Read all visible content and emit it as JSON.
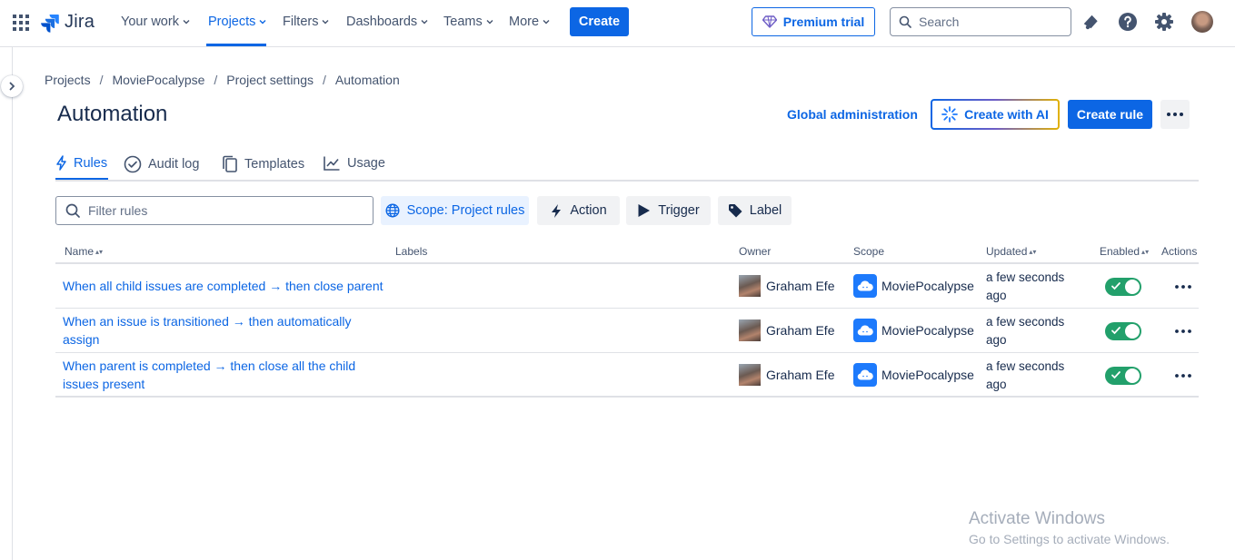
{
  "topnav": {
    "logo_text": "Jira",
    "items": [
      {
        "label": "Your work",
        "active": false
      },
      {
        "label": "Projects",
        "active": true
      },
      {
        "label": "Filters",
        "active": false
      },
      {
        "label": "Dashboards",
        "active": false
      },
      {
        "label": "Teams",
        "active": false
      },
      {
        "label": "More",
        "active": false
      }
    ],
    "create_label": "Create",
    "premium_label": "Premium trial",
    "search_placeholder": "Search",
    "icons": [
      "notifications-icon",
      "help-icon",
      "settings-icon",
      "profile-avatar"
    ]
  },
  "breadcrumb": [
    "Projects",
    "MoviePocalypse",
    "Project settings",
    "Automation"
  ],
  "page": {
    "title": "Automation",
    "global_admin_label": "Global administration",
    "create_ai_label": "Create with AI",
    "create_rule_label": "Create rule"
  },
  "tabs": [
    {
      "label": "Rules",
      "icon": "lightning-icon",
      "active": true
    },
    {
      "label": "Audit log",
      "icon": "check-circle-icon",
      "active": false
    },
    {
      "label": "Templates",
      "icon": "copy-icon",
      "active": false
    },
    {
      "label": "Usage",
      "icon": "chart-icon",
      "active": false
    }
  ],
  "filters": {
    "search_placeholder": "Filter rules",
    "scope_label": "Scope: Project rules",
    "action_label": "Action",
    "trigger_label": "Trigger",
    "label_label": "Label"
  },
  "table": {
    "headers": {
      "name": "Name",
      "labels": "Labels",
      "owner": "Owner",
      "scope": "Scope",
      "updated": "Updated",
      "enabled": "Enabled",
      "actions": "Actions"
    },
    "rows": [
      {
        "name": "When all child issues are completed → then close parent",
        "owner": "Graham Efe",
        "scope": "MoviePocalypse",
        "updated": "a few seconds ago",
        "enabled": true
      },
      {
        "name": "When an issue is transitioned → then automatically assign",
        "owner": "Graham Efe",
        "scope": "MoviePocalypse",
        "updated": "a few seconds ago",
        "enabled": true
      },
      {
        "name": "When parent is completed → then close all the child issues present",
        "owner": "Graham Efe",
        "scope": "MoviePocalypse",
        "updated": "a few seconds ago",
        "enabled": true
      }
    ]
  },
  "watermark": {
    "title": "Activate Windows",
    "subtitle": "Go to Settings to activate Windows."
  },
  "colors": {
    "primary": "#0c66e4",
    "toggle_on": "#22a06b",
    "text": "#172b4d",
    "subtle_text": "#44546f"
  }
}
